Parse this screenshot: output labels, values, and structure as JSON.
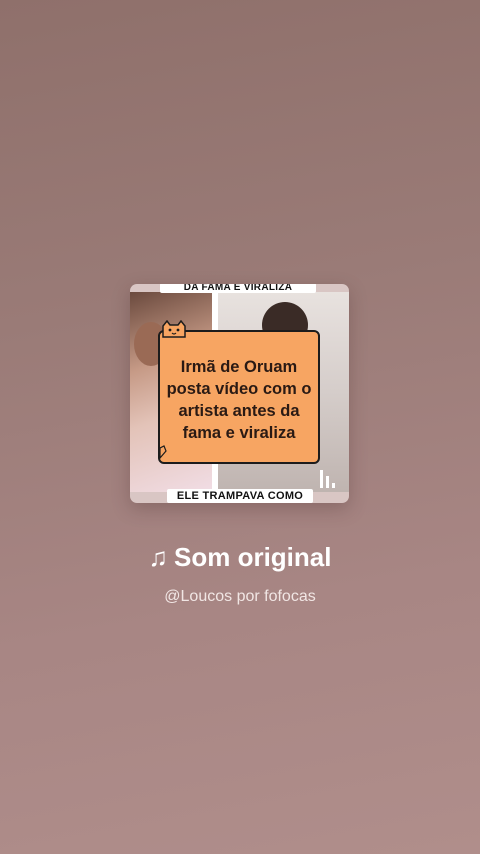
{
  "cover": {
    "top_banner": "DA FAMA E VIRALIZA",
    "headline": "Irmã de Oruam posta vídeo com o artista antes da fama e viraliza",
    "bottom_banner": "ELE TRAMPAVA COMO"
  },
  "audio": {
    "note_symbol": "♫",
    "title": "Som original",
    "author": "@Loucos por fofocas"
  },
  "icons": {
    "mascot": "cat-mascot-icon",
    "bars": "audio-bars-icon",
    "note": "music-note-icon"
  },
  "colors": {
    "background": "#9a7b77",
    "card": "#f7a562",
    "text": "#ffffff"
  }
}
